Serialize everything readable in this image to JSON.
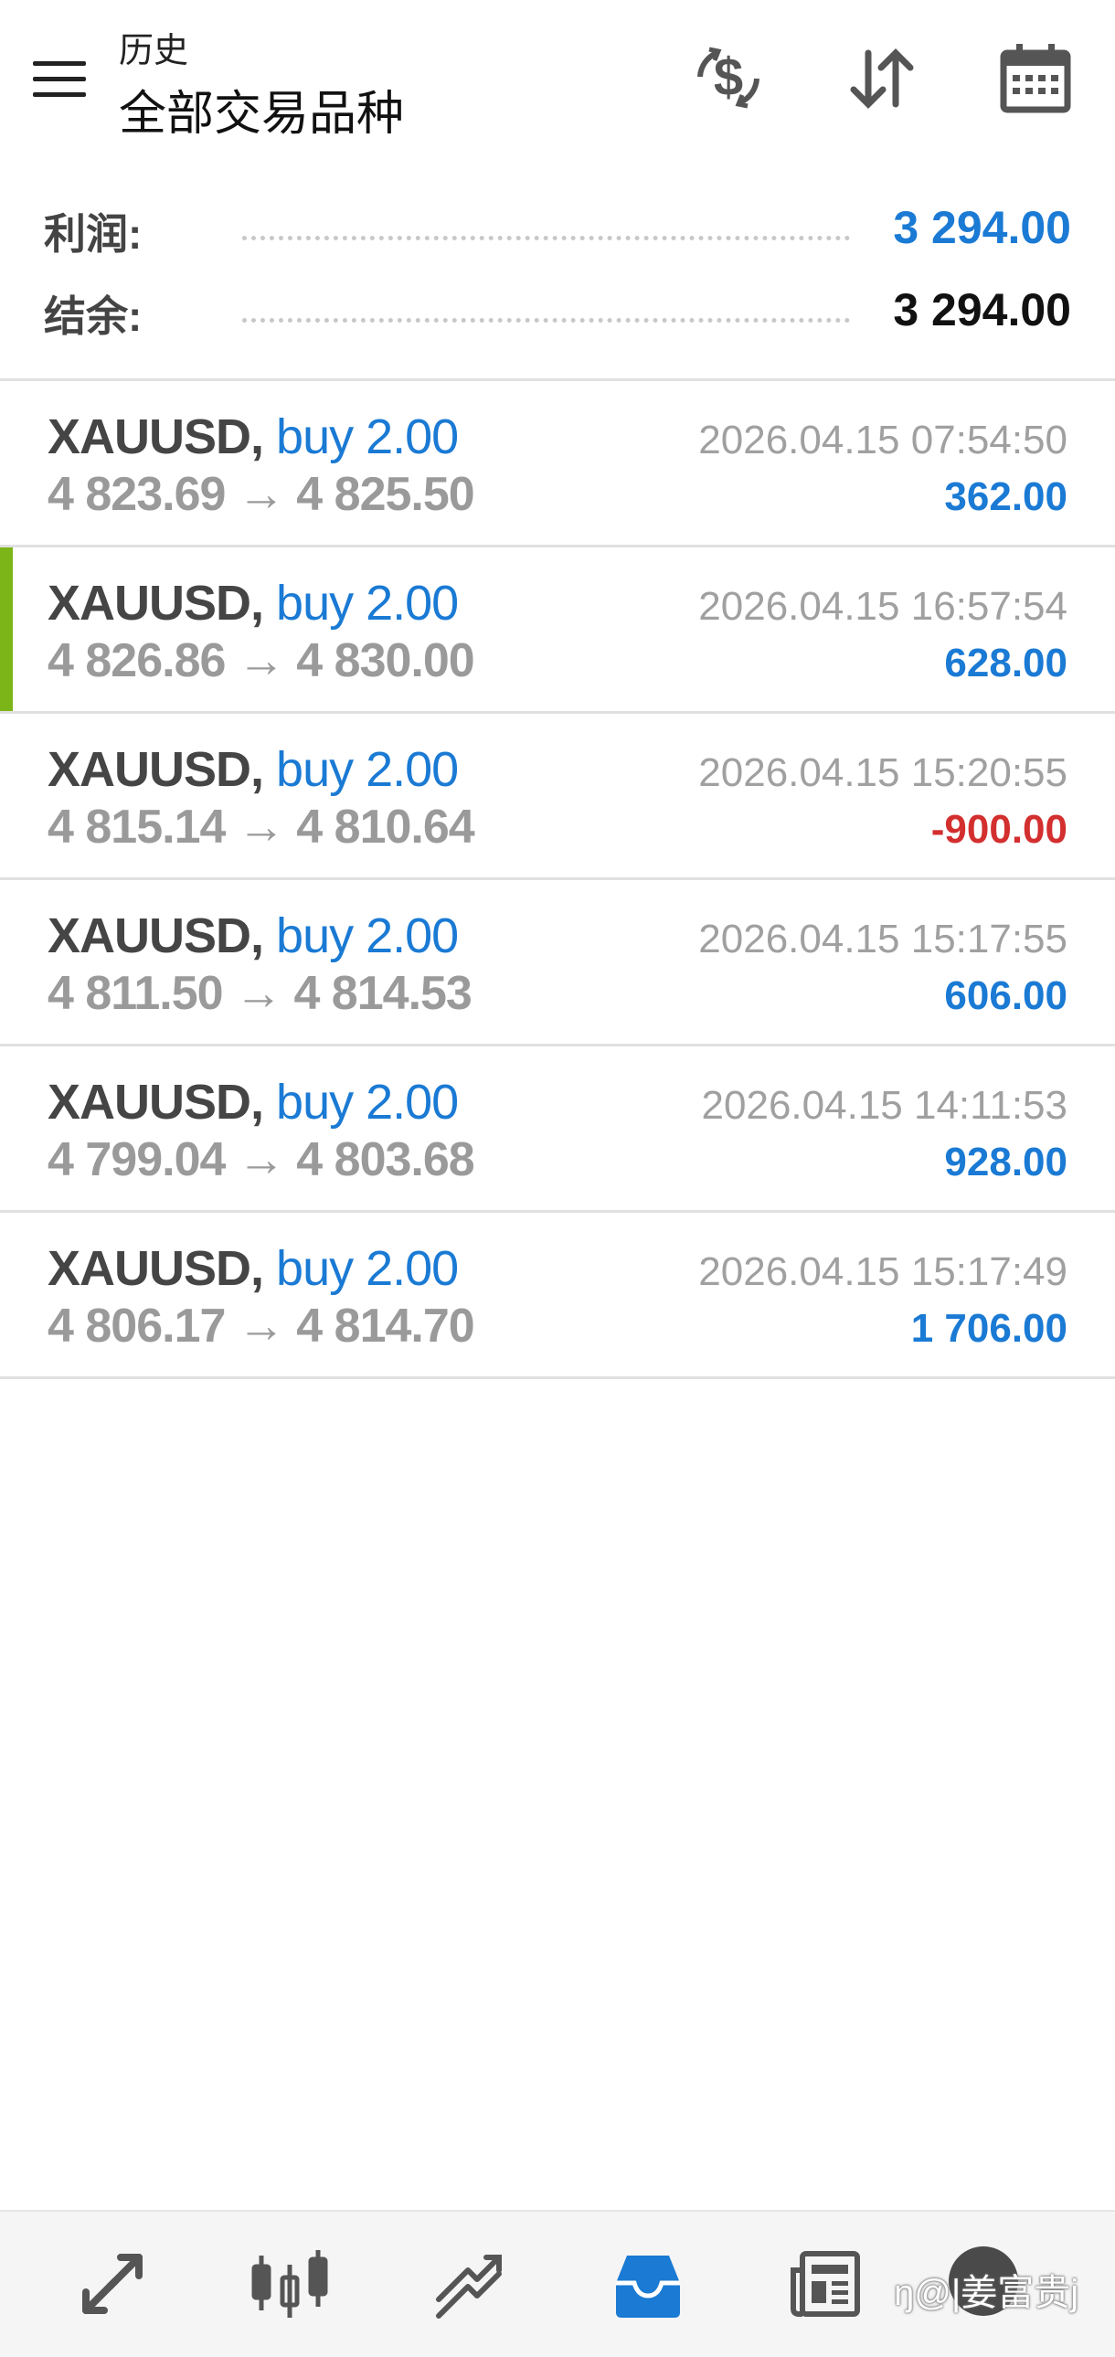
{
  "header": {
    "title_small": "历史",
    "title_big": "全部交易品种",
    "icons": [
      "menu-icon",
      "currency-icon",
      "sort-icon",
      "calendar-icon"
    ]
  },
  "summary": {
    "profit_label": "利润:",
    "profit_value": "3 294.00",
    "balance_label": "结余:",
    "balance_value": "3 294.00"
  },
  "deals": [
    {
      "symbol": "XAUUSD,",
      "type": "buy 2.00",
      "prices": "4 823.69 → 4 825.50",
      "time": "2026.04.15 07:54:50",
      "profit": "362.00",
      "profit_sign": "pos",
      "selected": false
    },
    {
      "symbol": "XAUUSD,",
      "type": "buy 2.00",
      "prices": "4 826.86 → 4 830.00",
      "time": "2026.04.15 16:57:54",
      "profit": "628.00",
      "profit_sign": "pos",
      "selected": true
    },
    {
      "symbol": "XAUUSD,",
      "type": "buy 2.00",
      "prices": "4 815.14 → 4 810.64",
      "time": "2026.04.15 15:20:55",
      "profit": "-900.00",
      "profit_sign": "neg",
      "selected": false
    },
    {
      "symbol": "XAUUSD,",
      "type": "buy 2.00",
      "prices": "4 811.50 → 4 814.53",
      "time": "2026.04.15 15:17:55",
      "profit": "606.00",
      "profit_sign": "pos",
      "selected": false
    },
    {
      "symbol": "XAUUSD,",
      "type": "buy 2.00",
      "prices": "4 799.04 → 4 803.68",
      "time": "2026.04.15 14:11:53",
      "profit": "928.00",
      "profit_sign": "pos",
      "selected": false
    },
    {
      "symbol": "XAUUSD,",
      "type": "buy 2.00",
      "prices": "4 806.17 → 4 814.70",
      "time": "2026.04.15 15:17:49",
      "profit": "1 706.00",
      "profit_sign": "pos",
      "selected": false
    }
  ],
  "bottom_nav": {
    "items": [
      "quotes-icon",
      "chart-icon",
      "trade-icon",
      "history-icon",
      "news-icon",
      "chat-icon"
    ],
    "active": "history-icon",
    "watermark": "ŋ@|姜富贵j"
  },
  "colors": {
    "accent_blue": "#1a7ad4",
    "loss_red": "#d32f2f",
    "selected_bar": "#7cb518",
    "icon_gray": "#555555"
  }
}
